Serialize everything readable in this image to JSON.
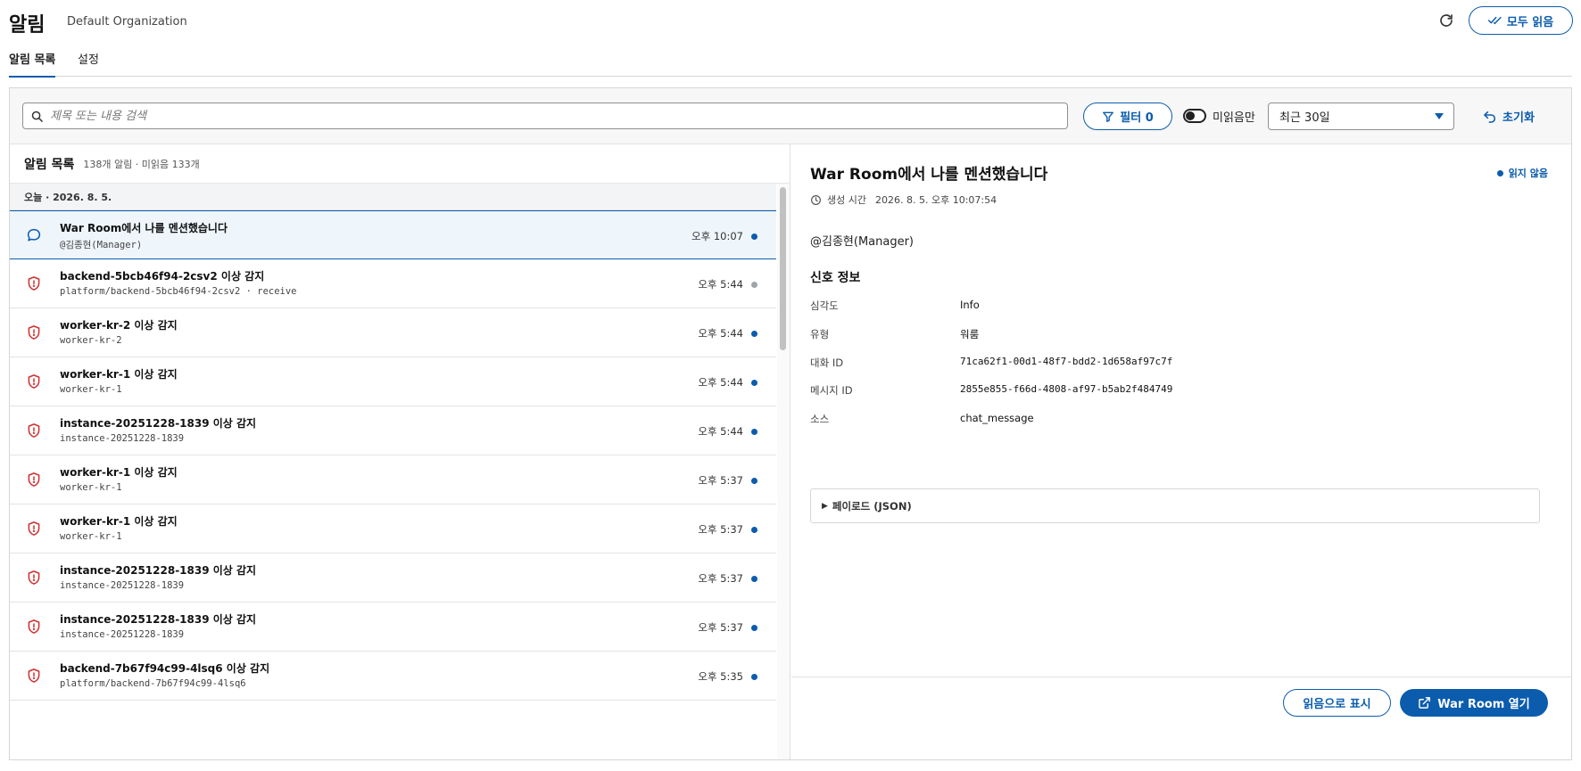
{
  "header": {
    "title": "알림",
    "org": "Default Organization",
    "read_all_label": "모두 읽음"
  },
  "tabs": [
    {
      "label": "알림 목록",
      "active": true
    },
    {
      "label": "설정",
      "active": false
    }
  ],
  "toolbar": {
    "search_placeholder": "제목 또는 내용 검색",
    "search_value": "",
    "filter_label": "필터 0",
    "unread_only_label": "미읽음만",
    "unread_only_on": false,
    "date_range_value": "최근 30일",
    "reset_label": "초기화"
  },
  "list": {
    "title": "알림 목록",
    "count_text": "138개 알림 · 미읽음 133개",
    "group_label": "오늘 · 2026. 8. 5.",
    "items": [
      {
        "icon": "chat-icon",
        "title": "War Room에서 나를 멘션했습니다",
        "sub": "@김종현(Manager)",
        "time": "오후 10:07",
        "status": "unread",
        "selected": true
      },
      {
        "icon": "shield-alert-icon",
        "title": "backend-5bcb46f94-2csv2 이상 감지",
        "sub": "platform/backend-5bcb46f94-2csv2 · receive",
        "time": "오후 5:44",
        "status": "read",
        "selected": false
      },
      {
        "icon": "shield-alert-icon",
        "title": "worker-kr-2 이상 감지",
        "sub": "worker-kr-2",
        "time": "오후 5:44",
        "status": "unread",
        "selected": false
      },
      {
        "icon": "shield-alert-icon",
        "title": "worker-kr-1 이상 감지",
        "sub": "worker-kr-1",
        "time": "오후 5:44",
        "status": "unread",
        "selected": false
      },
      {
        "icon": "shield-alert-icon",
        "title": "instance-20251228-1839 이상 감지",
        "sub": "instance-20251228-1839",
        "time": "오후 5:44",
        "status": "unread",
        "selected": false
      },
      {
        "icon": "shield-alert-icon",
        "title": "worker-kr-1 이상 감지",
        "sub": "worker-kr-1",
        "time": "오후 5:37",
        "status": "unread",
        "selected": false
      },
      {
        "icon": "shield-alert-icon",
        "title": "worker-kr-1 이상 감지",
        "sub": "worker-kr-1",
        "time": "오후 5:37",
        "status": "unread",
        "selected": false
      },
      {
        "icon": "shield-alert-icon",
        "title": "instance-20251228-1839 이상 감지",
        "sub": "instance-20251228-1839",
        "time": "오후 5:37",
        "status": "unread",
        "selected": false
      },
      {
        "icon": "shield-alert-icon",
        "title": "instance-20251228-1839 이상 감지",
        "sub": "instance-20251228-1839",
        "time": "오후 5:37",
        "status": "unread",
        "selected": false
      },
      {
        "icon": "shield-alert-icon",
        "title": "backend-7b67f94c99-4lsq6 이상 감지",
        "sub": "platform/backend-7b67f94c99-4lsq6",
        "time": "오후 5:35",
        "status": "unread",
        "selected": false
      }
    ]
  },
  "detail": {
    "title": "War Room에서 나를 멘션했습니다",
    "status_label": "읽지 않음",
    "created_label": "생성 시간",
    "created_value": "2026. 8. 5. 오후 10:07:54",
    "body": "@김종현(Manager)",
    "section_title": "신호 정보",
    "fields": [
      {
        "key": "심각도",
        "value": "Info",
        "mono": false
      },
      {
        "key": "유형",
        "value": "워룸",
        "mono": false
      },
      {
        "key": "대화 ID",
        "value": "71ca62f1-00d1-48f7-bdd2-1d658af97c7f",
        "mono": true
      },
      {
        "key": "메시지 ID",
        "value": "2855e855-f66d-4808-af97-b5ab2f484749",
        "mono": true
      },
      {
        "key": "소스",
        "value": "chat_message",
        "mono": false
      }
    ],
    "payload_label": "페이로드 (JSON)",
    "mark_read_label": "읽음으로 표시",
    "open_label": "War Room 열기"
  },
  "colors": {
    "accent": "#0b5cad",
    "unread_dot": "#0b5cad",
    "read_dot": "#a0a4aa",
    "alert_icon": "#d32f2f"
  }
}
